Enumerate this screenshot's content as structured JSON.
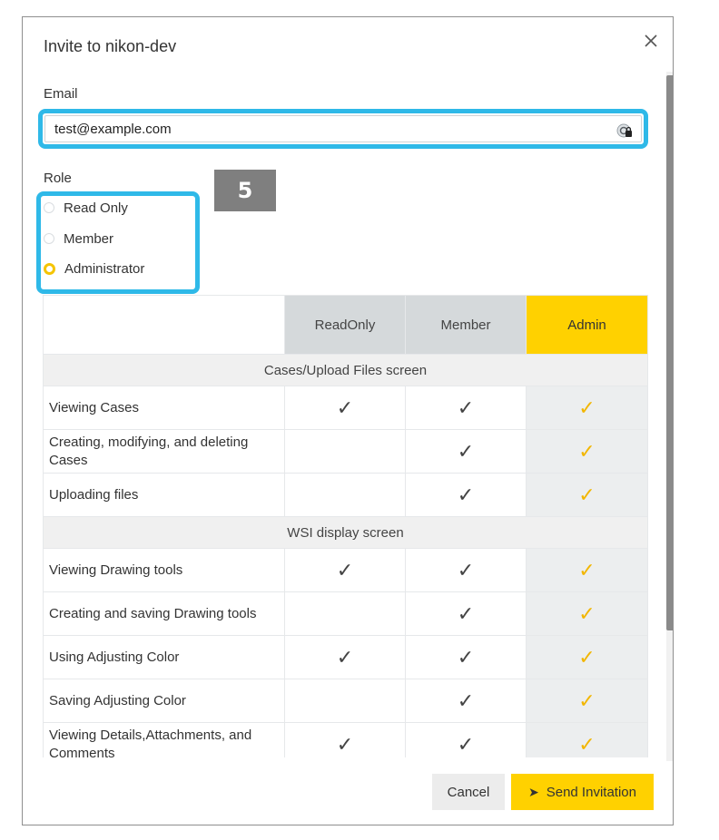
{
  "dialog": {
    "title": "Invite to nikon-dev",
    "close_icon": "close-icon"
  },
  "email": {
    "label": "Email",
    "value": "test@example.com",
    "icon": "password-manager-icon"
  },
  "step_badge": "5",
  "role": {
    "label": "Role",
    "options": [
      {
        "label": "Read Only",
        "selected": false
      },
      {
        "label": "Member",
        "selected": false
      },
      {
        "label": "Administrator",
        "selected": true
      }
    ]
  },
  "table": {
    "columns": [
      "ReadOnly",
      "Member",
      "Admin"
    ],
    "sections": [
      {
        "title": "Cases/Upload Files screen",
        "rows": [
          {
            "label": "Viewing Cases",
            "readonly": "✓",
            "member": "✓",
            "admin": "✓"
          },
          {
            "label": "Creating, modifying, and deleting Cases",
            "readonly": "",
            "member": "✓",
            "admin": "✓"
          },
          {
            "label": "Uploading files",
            "readonly": "",
            "member": "✓",
            "admin": "✓"
          }
        ]
      },
      {
        "title": "WSI display screen",
        "rows": [
          {
            "label": "Viewing Drawing tools",
            "readonly": "✓",
            "member": "✓",
            "admin": "✓"
          },
          {
            "label": "Creating and saving Drawing tools",
            "readonly": "",
            "member": "✓",
            "admin": "✓"
          },
          {
            "label": "Using Adjusting Color",
            "readonly": "✓",
            "member": "✓",
            "admin": "✓"
          },
          {
            "label": "Saving Adjusting Color",
            "readonly": "",
            "member": "✓",
            "admin": "✓"
          },
          {
            "label": "Viewing Details,Attachments, and Comments",
            "readonly": "✓",
            "member": "✓",
            "admin": "✓"
          }
        ]
      }
    ]
  },
  "footer": {
    "cancel_label": "Cancel",
    "send_label": "Send Invitation",
    "send_icon": "send-arrow-icon"
  },
  "colors": {
    "accent": "#ffd100",
    "highlight": "#2fb9e8"
  }
}
